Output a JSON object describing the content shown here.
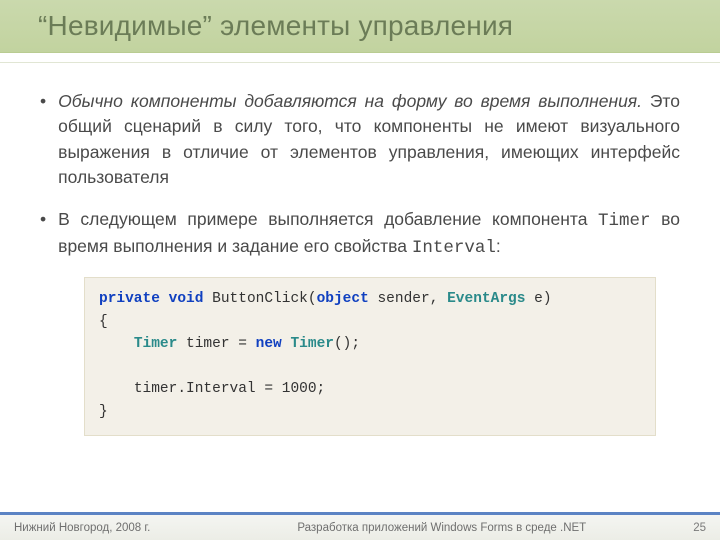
{
  "title": "“Невидимые” элементы управления",
  "bullets": [
    {
      "italic_lead": "Обычно компоненты добавляются на форму во время выполнения.",
      "rest": " Это общий сценарий в силу того, что компоненты не имеют визуального выражения в отличие от элементов управления, имеющих интерфейс пользователя"
    },
    {
      "pre1": "В следующем примере выполняется добавление компонента ",
      "mono1": "Timer",
      "mid": " во время выполнения и задание его свойства ",
      "mono2": "Interval",
      "post": ":"
    }
  ],
  "code": {
    "l1_kw1": "private",
    "l1_sp1": " ",
    "l1_kw2": "void",
    "l1_sp2": " ",
    "l1_name": "ButtonClick(",
    "l1_kw3": "object",
    "l1_sp3": " ",
    "l1_arg": "sender, ",
    "l1_type": "EventArgs",
    "l1_end": " e)",
    "l2": "{",
    "l3_indent": "    ",
    "l3_type1": "Timer",
    "l3_sp1": " ",
    "l3_var": "timer = ",
    "l3_kw": "new",
    "l3_sp2": " ",
    "l3_type2": "Timer",
    "l3_end": "();",
    "l4": "",
    "l5_indent": "    ",
    "l5": "timer.Interval = 1000;",
    "l6": "}"
  },
  "footer": {
    "left": "Нижний Новгород, 2008 г.",
    "center": "Разработка приложений Windows Forms в среде .NET",
    "page": "25"
  }
}
